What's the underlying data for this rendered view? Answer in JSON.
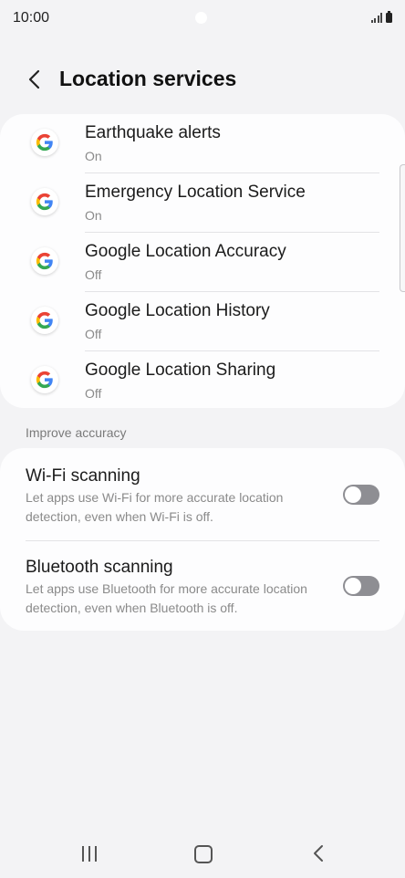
{
  "status_bar": {
    "time": "10:00"
  },
  "header": {
    "title": "Location services"
  },
  "services": [
    {
      "title": "Earthquake alerts",
      "status": "On",
      "icon": "google-icon"
    },
    {
      "title": "Emergency Location Service",
      "status": "On",
      "icon": "google-icon"
    },
    {
      "title": "Google Location Accuracy",
      "status": "Off",
      "icon": "google-icon"
    },
    {
      "title": "Google Location History",
      "status": "Off",
      "icon": "google-icon"
    },
    {
      "title": "Google Location Sharing",
      "status": "Off",
      "icon": "google-icon"
    }
  ],
  "improve_accuracy": {
    "header": "Improve accuracy",
    "items": [
      {
        "title": "Wi-Fi scanning",
        "description": "Let apps use Wi-Fi for more accurate location detection, even when Wi-Fi is off.",
        "enabled": false
      },
      {
        "title": "Bluetooth scanning",
        "description": "Let apps use Bluetooth for more accurate location detection, even when Bluetooth is off.",
        "enabled": false
      }
    ]
  },
  "colors": {
    "background": "#f3f3f5",
    "card": "#fdfdfe",
    "switch_off": "#8e8e93",
    "google_blue": "#4285F4",
    "google_red": "#EA4335",
    "google_yellow": "#FBBC05",
    "google_green": "#34A853"
  }
}
